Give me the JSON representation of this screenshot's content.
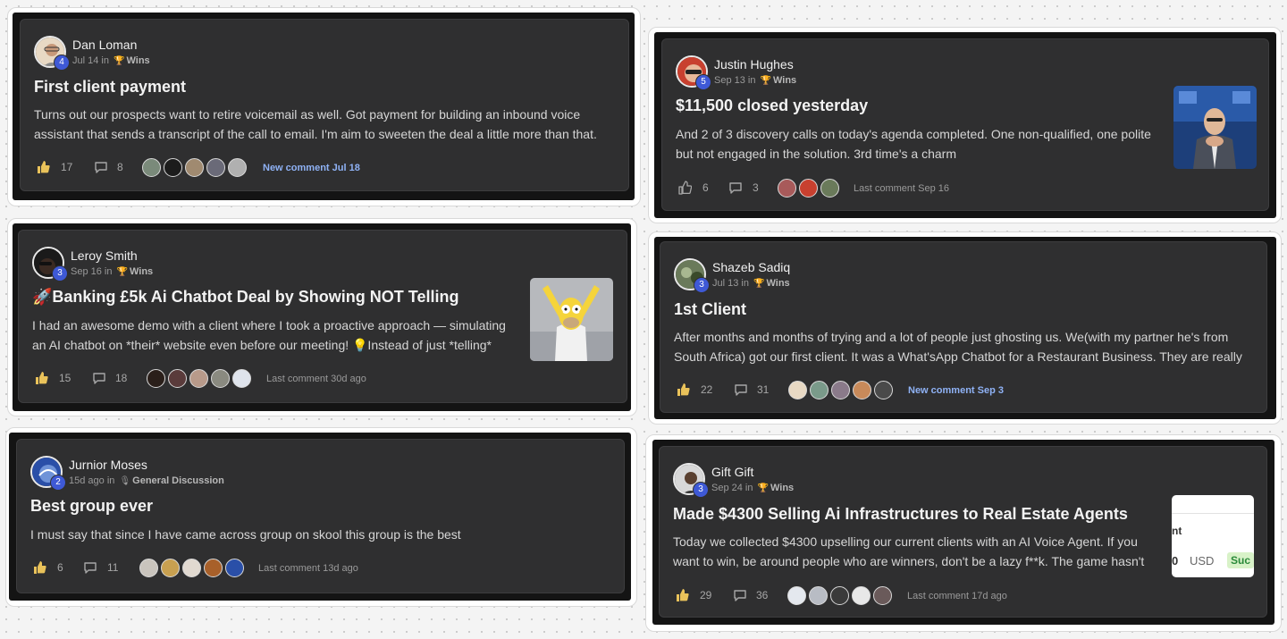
{
  "posts": [
    {
      "author": "Dan Loman",
      "level": "4",
      "date": "Jul 14 in",
      "category": "Wins",
      "title": "First client payment",
      "body": "Turns out our prospects want to retire voicemail as well. Got payment for building an inbound voice assistant that sends a transcript of the call to email. I'm aim to sweeten the deal a little more than that.",
      "likes": "17",
      "comments": "8",
      "status": "New comment Jul 18",
      "status_kind": "new",
      "has_thumb": false
    },
    {
      "author": "Leroy Smith",
      "level": "3",
      "date": "Sep 16 in",
      "category": "Wins",
      "title": "🚀Banking £5k Ai Chatbot Deal by Showing NOT Telling",
      "body": "I had an awesome demo with a client where I took a proactive approach — simulating an AI chatbot on *their* website even before our meeting! 💡Instead of just *telling*",
      "likes": "15",
      "comments": "18",
      "status": "Last comment 30d ago",
      "status_kind": "last",
      "has_thumb": true
    },
    {
      "author": "Jurnior Moses",
      "level": "2",
      "date": "15d ago in",
      "category": "General Discussion",
      "title": "Best group ever",
      "body": "I must say that since I have came across group on skool this group is the best",
      "likes": "6",
      "comments": "11",
      "status": "Last comment 13d ago",
      "status_kind": "last",
      "has_thumb": false
    },
    {
      "author": "Justin Hughes",
      "level": "5",
      "date": "Sep 13 in",
      "category": "Wins",
      "title": "$11,500 closed yesterday",
      "body": "And 2 of 3 discovery calls on today's agenda completed. One non-qualified, one polite but not engaged in the solution. 3rd time's a charm",
      "likes": "6",
      "comments": "3",
      "status": "Last comment Sep 16",
      "status_kind": "last",
      "has_thumb": true
    },
    {
      "author": "Shazeb Sadiq",
      "level": "3",
      "date": "Jul 13 in",
      "category": "Wins",
      "title": "1st Client",
      "body": "After months and months of trying and a lot of people just ghosting us. We(with my partner he's from South Africa) got our first client. It was a What'sApp Chatbot for a Restaurant Business. They are really",
      "likes": "22",
      "comments": "31",
      "status": "New comment Sep 3",
      "status_kind": "new",
      "has_thumb": false
    },
    {
      "author": "Gift Gift",
      "level": "3",
      "date": "Sep 24 in",
      "category": "Wins",
      "title": "Made $4300 Selling Ai Infrastructures to Real Estate Agents",
      "body": "Today we collected $4300 upselling our current clients with an AI Voice Agent. If you want to win, be around people who are winners, don't be a lazy f**k. The game hasn't",
      "likes": "29",
      "comments": "36",
      "status": "Last comment 17d ago",
      "status_kind": "last",
      "has_thumb": true,
      "thumb_text": {
        "a": "nt",
        "b": "0",
        "c": "USD",
        "d": "Suc"
      }
    }
  ],
  "icons": {
    "like": "thumbs-up-icon",
    "comment": "comment-bubble-icon",
    "category_wins": "trophy-icon",
    "category_general": "microphone-icon"
  },
  "colors": {
    "card": "#2f2f30",
    "new_comment": "#8fb2f5",
    "level_badge": "#3e59d6",
    "background": "#f4f4f4"
  }
}
